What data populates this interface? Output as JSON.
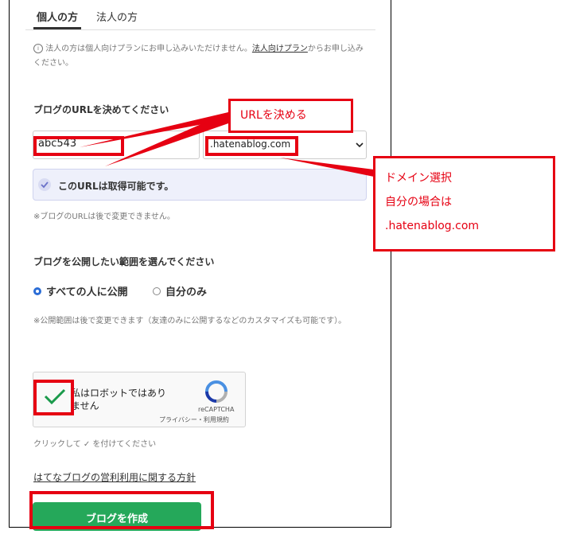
{
  "tabs": {
    "individual": "個人の方",
    "corporate": "法人の方"
  },
  "notice": {
    "icon": "info-icon",
    "text_before": "法人の方は個人向けプランにお申し込みいただけません。",
    "link": "法人向けプラン",
    "text_after": "からお申し込みください。"
  },
  "url_section": {
    "label": "ブログのURLを決めてください",
    "subdomain_value": "abc543",
    "domain_value": ".hatenablog.com",
    "availability": "このURLは取得可能です。",
    "note": "※ブログのURLは後で変更できません。"
  },
  "visibility": {
    "label": "ブログを公開したい範囲を選んでください",
    "options": [
      "すべての人に公開",
      "自分のみ"
    ],
    "selected": "すべての人に公開",
    "note": "※公開範囲は後で変更できます（友達のみに公開するなどのカスタマイズも可能です）。"
  },
  "recaptcha": {
    "label": "私はロボットではありません",
    "brand": "reCAPTCHA",
    "links": "プライバシー・利用規約",
    "hint": "クリックして ✓ を付けてください"
  },
  "policy_link": "はてなブログの営利利用に関する方針",
  "create_button": "ブログを作成",
  "annotations": {
    "url_callout": "URLを決める",
    "domain_callout": [
      "ドメイン選択",
      "自分の場合は",
      ".hatenablog.com"
    ]
  },
  "colors": {
    "annotation_red": "#e60012",
    "button_green": "#25a85a",
    "check_green": "#1a9a4b",
    "radio_blue": "#2b6dd6",
    "availability_bg": "#eef0fb"
  }
}
